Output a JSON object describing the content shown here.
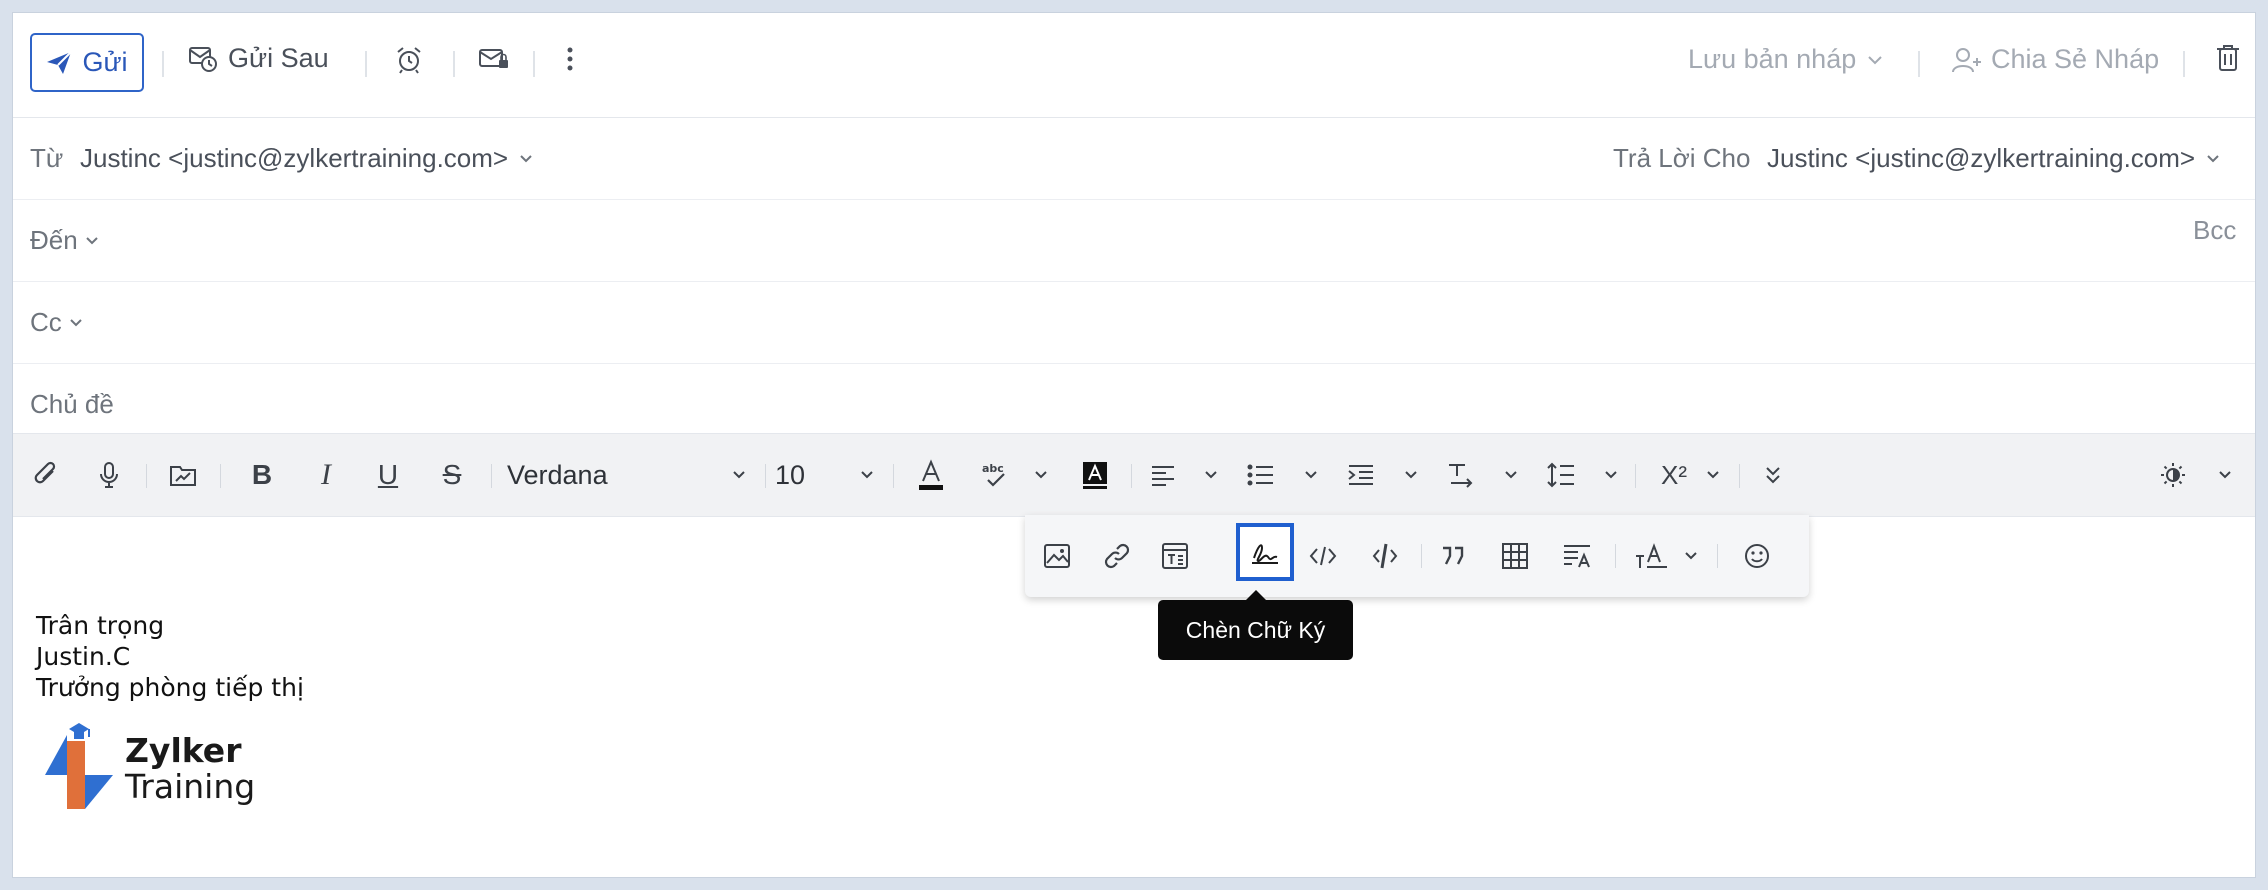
{
  "toolbar": {
    "send_label": "Gửi",
    "send_later_label": "Gửi Sau",
    "save_draft_label": "Lưu bản nháp",
    "share_draft_label": "Chia Sẻ Nháp"
  },
  "header": {
    "from_label": "Từ",
    "from_value": "Justinc <justinc@zylkertraining.com>",
    "reply_to_label": "Trả Lời Cho",
    "reply_to_value": "Justinc <justinc@zylkertraining.com>",
    "to_label": "Đến",
    "bcc_label": "Bcc",
    "cc_label": "Cc",
    "subject_label": "Chủ đề"
  },
  "format": {
    "font": "Verdana",
    "size": "10",
    "bold": "B",
    "italic": "I",
    "underline": "U",
    "strike": "S",
    "superscript": "X²"
  },
  "tooltip": "Chèn Chữ Ký",
  "body": {
    "lines": [
      "Trân trọng",
      "Justin.C",
      "Trưởng phòng tiếp thị"
    ],
    "logo_name": "Zylker",
    "logo_sub": "Training"
  },
  "colors": {
    "accent": "#2f64c8",
    "focus": "#1f5fcf",
    "logo_blue": "#2f6fd1",
    "logo_orange": "#e0703a"
  }
}
